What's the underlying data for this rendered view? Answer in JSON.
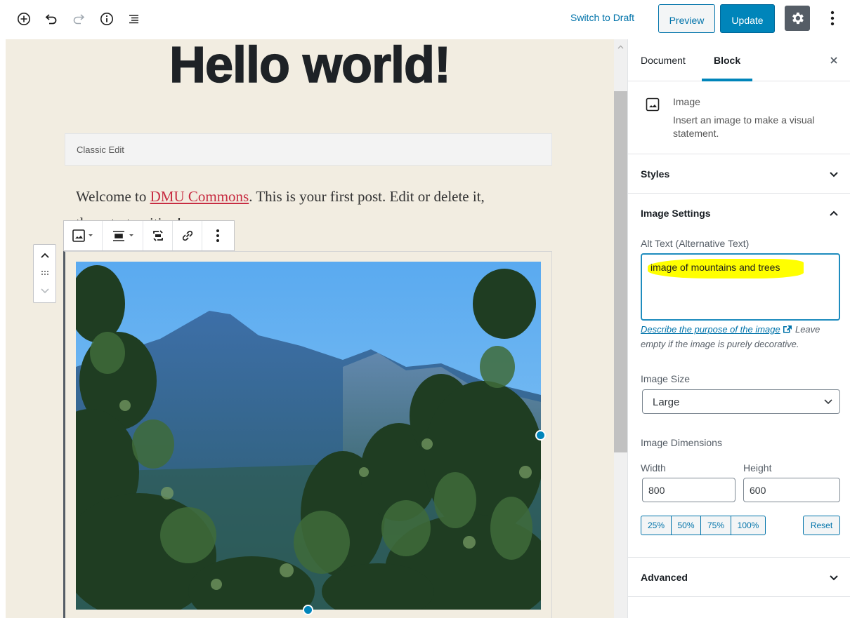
{
  "toolbar": {
    "switch_to_draft": "Switch to Draft",
    "preview_label": "Preview",
    "update_label": "Update",
    "icons": [
      "add-block-icon",
      "undo-icon",
      "redo-icon",
      "info-icon",
      "outline-icon",
      "gear-icon",
      "more-vertical-icon"
    ]
  },
  "editor": {
    "title": "Hello world!",
    "classic_label": "Classic Edit",
    "paragraph": {
      "before_link": "Welcome to ",
      "link_text": "DMU Commons",
      "after_link": ". This is your first post. Edit or delete it,",
      "line2": "then start writing!"
    },
    "block_toolbar_icons": [
      "image-icon",
      "align-icon",
      "replace-icon",
      "link-icon",
      "more-vertical-icon"
    ],
    "mover_icons": [
      "chevron-up-icon",
      "drag-handle-icon",
      "chevron-down-icon"
    ]
  },
  "sidebar": {
    "tabs": [
      {
        "label": "Document",
        "active": false
      },
      {
        "label": "Block",
        "active": true
      }
    ],
    "block_card": {
      "name": "Image",
      "description": "Insert an image to make a visual statement."
    },
    "styles_panel": {
      "title": "Styles",
      "expanded": false
    },
    "image_settings": {
      "title": "Image Settings",
      "expanded": true,
      "alt_label": "Alt Text (Alternative Text)",
      "alt_value": "image of mountains and trees",
      "help_link": "Describe the purpose of the image",
      "help_text": " Leave empty if the image is purely decorative.",
      "size_label": "Image Size",
      "size_value": "Large",
      "dimensions_label": "Image Dimensions",
      "width_label": "Width",
      "height_label": "Height",
      "width_value": "800",
      "height_value": "600",
      "percent_buttons": [
        "25%",
        "50%",
        "75%",
        "100%"
      ],
      "reset_label": "Reset"
    },
    "advanced_panel": {
      "title": "Advanced",
      "expanded": false
    }
  },
  "colors": {
    "accent": "#0085ba",
    "link": "#0073aa",
    "canvas_bg": "#f2ede1",
    "highlight": "#ffff00",
    "settings_button_bg": "#555d66"
  }
}
